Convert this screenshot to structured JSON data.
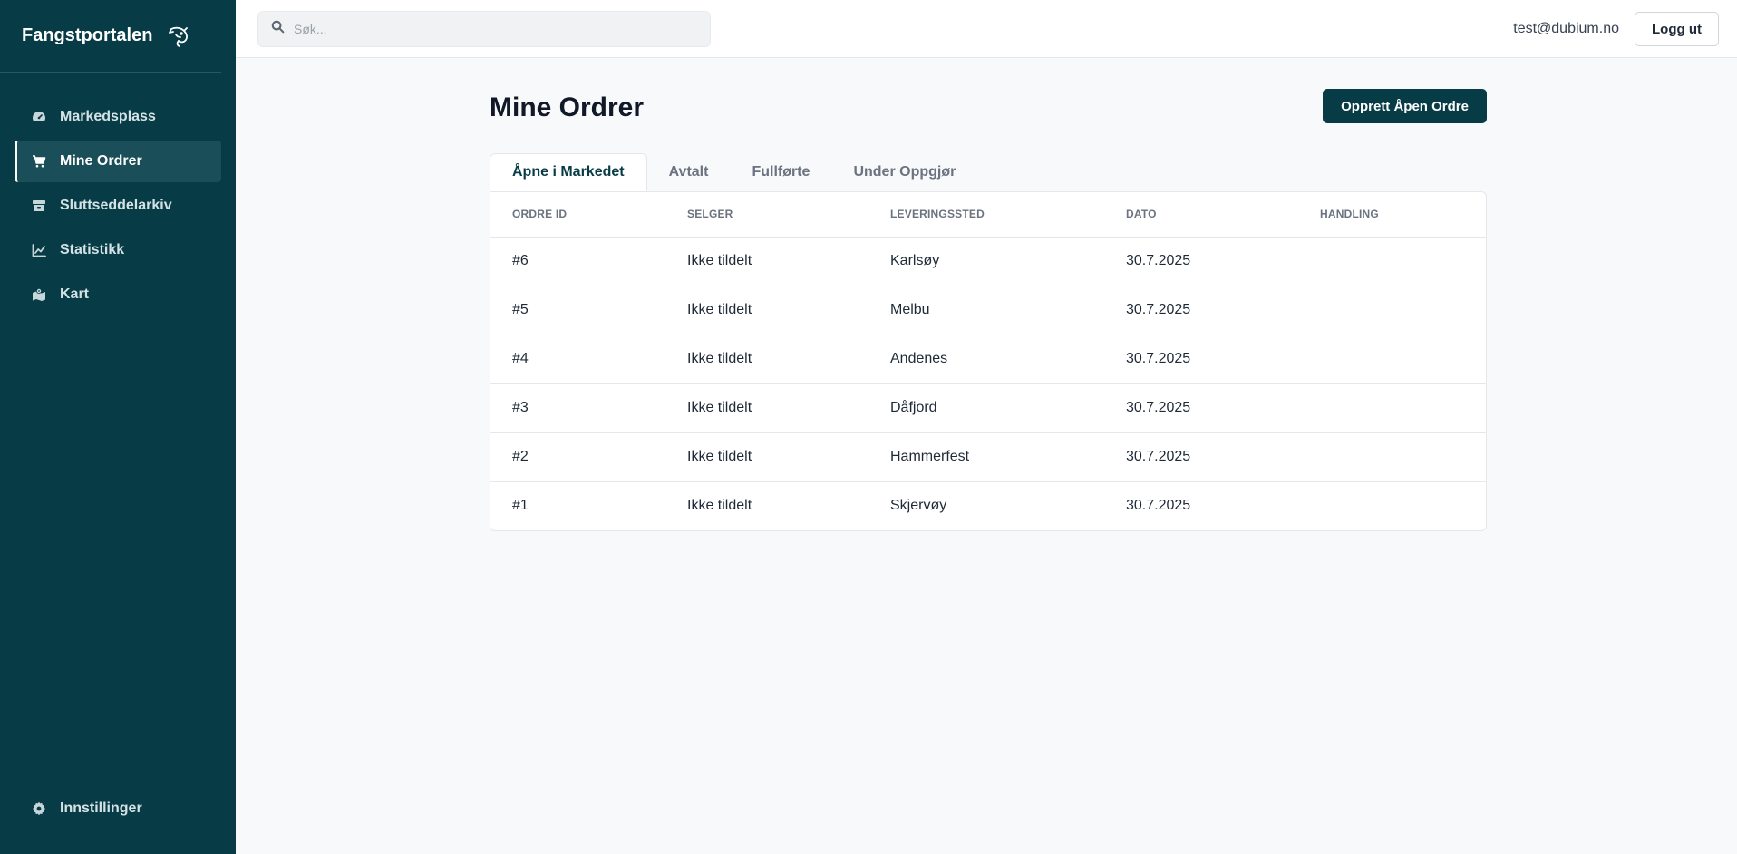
{
  "app": {
    "title": "Fangstportalen"
  },
  "sidebar": {
    "items": [
      {
        "label": "Markedsplass",
        "icon": "dashboard-gauge-icon"
      },
      {
        "label": "Mine Ordrer",
        "icon": "shopping-cart-icon",
        "active": true
      },
      {
        "label": "Sluttseddelarkiv",
        "icon": "archive-box-icon"
      },
      {
        "label": "Statistikk",
        "icon": "line-chart-icon"
      },
      {
        "label": "Kart",
        "icon": "map-icon"
      }
    ],
    "settings": {
      "label": "Innstillinger",
      "icon": "gear-icon"
    }
  },
  "header": {
    "search_placeholder": "Søk...",
    "user_email": "test@dubium.no",
    "logout_label": "Logg ut"
  },
  "page": {
    "title": "Mine Ordrer",
    "create_button": "Opprett Åpen Ordre",
    "tabs": [
      {
        "label": "Åpne i Markedet",
        "active": true
      },
      {
        "label": "Avtalt"
      },
      {
        "label": "Fullførte"
      },
      {
        "label": "Under Oppgjør"
      }
    ],
    "table": {
      "columns": [
        "ORDRE ID",
        "SELGER",
        "LEVERINGSSTED",
        "DATO",
        "HANDLING"
      ],
      "rows": [
        {
          "id": "#6",
          "seller": "Ikke tildelt",
          "place": "Karlsøy",
          "date": "30.7.2025",
          "action": ""
        },
        {
          "id": "#5",
          "seller": "Ikke tildelt",
          "place": "Melbu",
          "date": "30.7.2025",
          "action": ""
        },
        {
          "id": "#4",
          "seller": "Ikke tildelt",
          "place": "Andenes",
          "date": "30.7.2025",
          "action": ""
        },
        {
          "id": "#3",
          "seller": "Ikke tildelt",
          "place": "Dåfjord",
          "date": "30.7.2025",
          "action": ""
        },
        {
          "id": "#2",
          "seller": "Ikke tildelt",
          "place": "Hammerfest",
          "date": "30.7.2025",
          "action": ""
        },
        {
          "id": "#1",
          "seller": "Ikke tildelt",
          "place": "Skjervøy",
          "date": "30.7.2025",
          "action": ""
        }
      ]
    }
  },
  "colors": {
    "sidebar_bg": "#073c47",
    "accent": "#073c47",
    "page_bg": "#f8f9fa"
  }
}
